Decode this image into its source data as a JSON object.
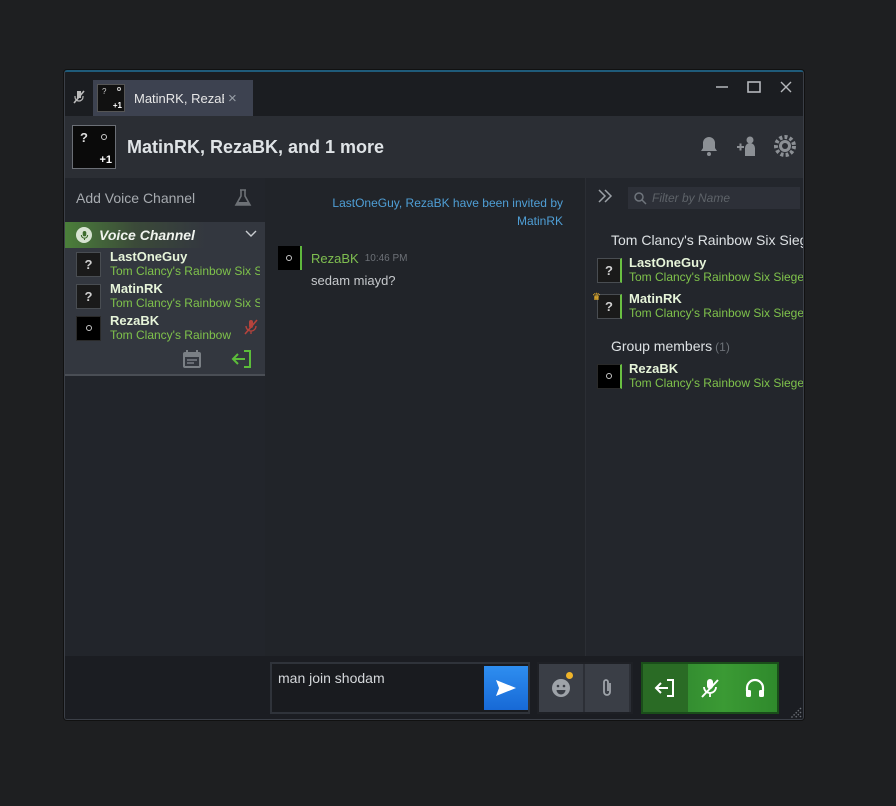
{
  "tab": {
    "title": "MatinRK, RezaBK",
    "close": "×",
    "avatar_extra": "+1"
  },
  "window_controls": {
    "minimize": "—",
    "maximize": "☐",
    "close": "✕"
  },
  "header": {
    "title": "MatinRK, RezaBK, and 1 more",
    "avatar_q": "?",
    "avatar_extra": "+1"
  },
  "left": {
    "add_voice_channel": "Add Voice Channel",
    "voice_channel": {
      "name": "Voice Channel",
      "members": [
        {
          "avatar": "?",
          "name": "LastOneGuy",
          "game": "Tom Clancy's Rainbow Six Siege"
        },
        {
          "avatar": "?",
          "name": "MatinRK",
          "game": "Tom Clancy's Rainbow Six Siege"
        },
        {
          "avatar": "",
          "name": "RezaBK",
          "game": "Tom Clancy's Rainbow Six Siege"
        }
      ]
    }
  },
  "chat": {
    "system_message": "LastOneGuy, RezaBK have been invited by MatinRK",
    "messages": [
      {
        "author": "RezaBK",
        "time": "10:46 PM",
        "text": "sedam miayd?"
      }
    ]
  },
  "right": {
    "filter_placeholder": "Filter by Name",
    "game_group": {
      "title": "Tom Clancy's Rainbow Six Siege",
      "members": [
        {
          "avatar": "?",
          "name": "LastOneGuy",
          "game": "Tom Clancy's Rainbow Six Siege"
        },
        {
          "avatar": "?",
          "name": "MatinRK",
          "game": "Tom Clancy's Rainbow Six Siege"
        }
      ]
    },
    "group_members": {
      "title": "Group members",
      "count": "(1)",
      "members": [
        {
          "avatar": "",
          "name": "RezaBK",
          "game": "Tom Clancy's Rainbow Six Siege"
        }
      ]
    }
  },
  "composer": {
    "value": "man join shodam"
  },
  "colors": {
    "accent_green": "#5cbd3a",
    "accent_blue": "#2e8ef0",
    "game_green": "#7fc24b"
  }
}
